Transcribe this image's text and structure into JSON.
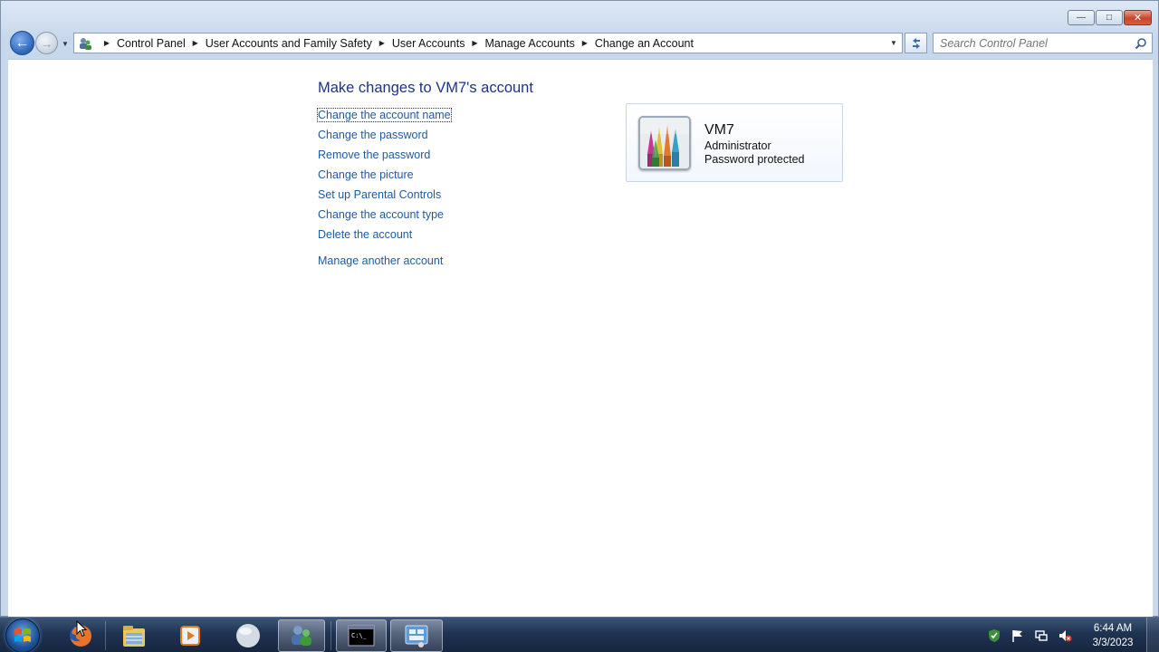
{
  "window": {
    "caption_buttons": {
      "minimize": "—",
      "maximize": "□",
      "close": "✕"
    }
  },
  "navbar": {
    "back_glyph": "←",
    "forward_glyph": "→",
    "breadcrumbs": [
      "Control Panel",
      "User Accounts and Family Safety",
      "User Accounts",
      "Manage Accounts",
      "Change an Account"
    ],
    "search_placeholder": "Search Control Panel"
  },
  "main": {
    "title": "Make changes to VM7's account",
    "tasks": [
      "Change the account name",
      "Change the password",
      "Remove the password",
      "Change the picture",
      "Set up Parental Controls",
      "Change the account type",
      "Delete the account"
    ],
    "other_task": "Manage another account",
    "account": {
      "name": "VM7",
      "type": "Administrator",
      "status": "Password protected",
      "picture": "crayons-icon"
    }
  },
  "taskbar": {
    "items": [
      "firefox-icon",
      "windows-explorer-icon",
      "media-player-icon",
      "blank-app-icon",
      "user-accounts-icon",
      "command-prompt-icon",
      "control-panel-icon"
    ],
    "clock_time": "6:44 AM",
    "clock_date": "3/3/2023"
  },
  "colors": {
    "link": "#1e5a9e",
    "title": "#1e3287",
    "taskbar": "#1f3352"
  }
}
